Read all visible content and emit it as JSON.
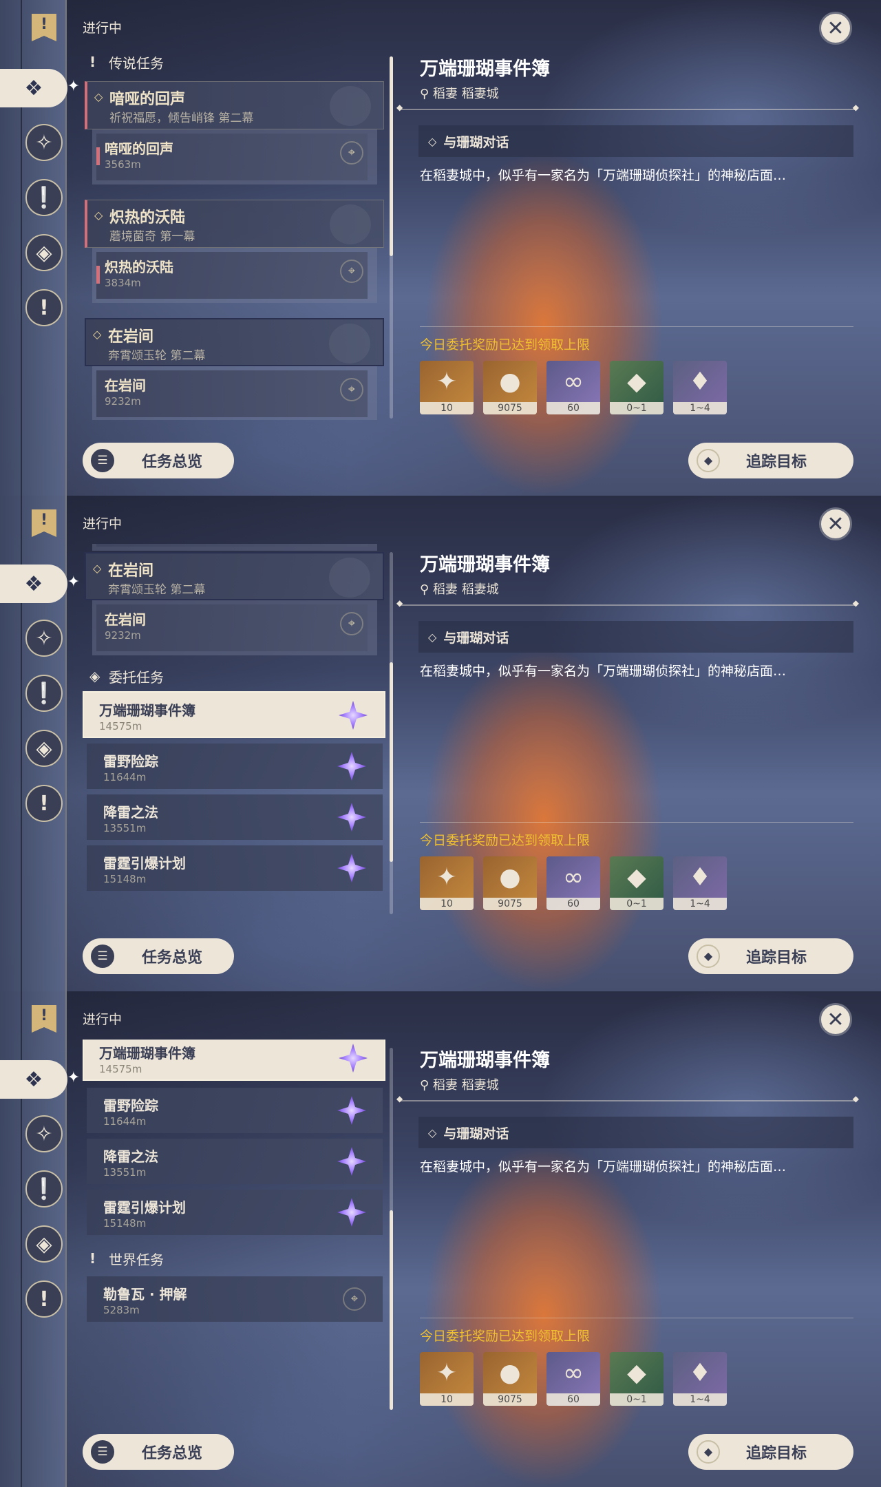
{
  "status_label": "进行中",
  "overview_button": "任务总览",
  "track_button": "追踪目标",
  "detail": {
    "title": "万端珊瑚事件簿",
    "location": "稻妻 稻妻城",
    "objective": "与珊瑚对话",
    "description": "在稻妻城中，似乎有一家名为「万端珊瑚侦探社」的神秘店面…",
    "reward_note": "今日委托奖励已达到领取上限",
    "rewards": [
      {
        "icon": "adventure-exp-icon",
        "qty": "10"
      },
      {
        "icon": "mora-icon",
        "qty": "9075"
      },
      {
        "icon": "companionship-exp-icon",
        "qty": "60"
      },
      {
        "icon": "mineral-ore-icon",
        "qty": "0~1"
      },
      {
        "icon": "primogem-crystal-icon",
        "qty": "1~4"
      }
    ]
  },
  "sections": {
    "legend": "传说任务",
    "commission": "委托任务",
    "world": "世界任务"
  },
  "legend_quests": [
    {
      "title": "喑哑的回声",
      "subtitle": "祈祝福愿，倾告峭锋 第二幕",
      "sub": {
        "name": "喑哑的回声",
        "dist": "3563m"
      }
    },
    {
      "title": "炽热的沃陆",
      "subtitle": "蘑境菌奇 第一幕",
      "sub": {
        "name": "炽热的沃陆",
        "dist": "3834m"
      }
    },
    {
      "title": "在岩间",
      "subtitle": "奔霄颂玉轮 第二幕",
      "sub": {
        "name": "在岩间",
        "dist": "9232m"
      }
    }
  ],
  "commissions": [
    {
      "name": "万端珊瑚事件簿",
      "dist": "14575m"
    },
    {
      "name": "雷野险踪",
      "dist": "11644m"
    },
    {
      "name": "降雷之法",
      "dist": "13551m"
    },
    {
      "name": "雷霆引爆计划",
      "dist": "15148m"
    }
  ],
  "world_quests": [
    {
      "name": "勒鲁瓦 · 押解",
      "dist": "5283m"
    }
  ],
  "colors": {
    "accent": "#ece5d8",
    "reward_note": "#f0c030",
    "commission_star": "#a884ff",
    "legend_bar": "#d4707a"
  }
}
